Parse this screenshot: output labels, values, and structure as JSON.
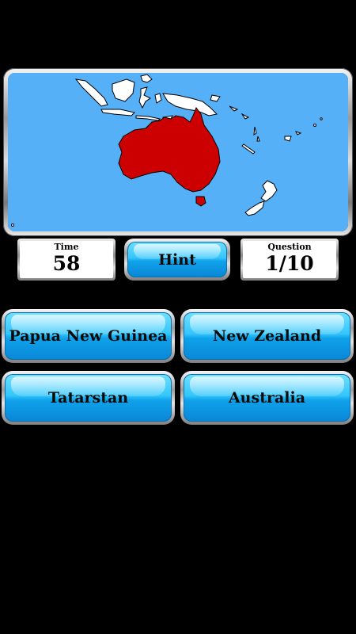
{
  "map": {
    "ocean_color": "#55b0f7",
    "land_color": "#ffffff",
    "highlight_color": "#cc0000",
    "highlighted_region": "Australia"
  },
  "stats": {
    "time_label": "Time",
    "time_value": "58",
    "question_label": "Question",
    "question_value": "1/10"
  },
  "hint": {
    "label": "Hint"
  },
  "answers": [
    {
      "label": "Papua New Guinea"
    },
    {
      "label": "New Zealand"
    },
    {
      "label": "Tatarstan"
    },
    {
      "label": "Australia"
    }
  ],
  "colors": {
    "button_top": "#6fe0ff",
    "button_bottom": "#0a86d6",
    "background": "#000000"
  }
}
